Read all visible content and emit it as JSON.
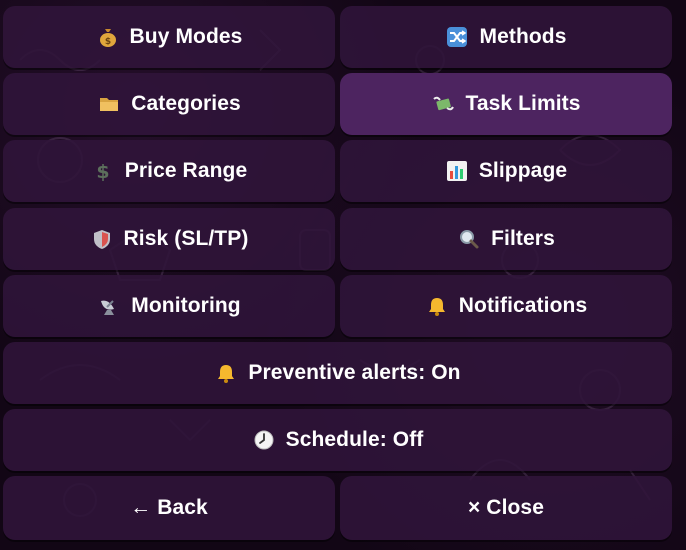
{
  "keyboard": {
    "rows": [
      [
        {
          "label": "Buy Modes",
          "icon": "money-bag-icon"
        },
        {
          "label": "Methods",
          "icon": "shuffle-icon"
        }
      ],
      [
        {
          "label": "Categories",
          "icon": "folder-icon"
        },
        {
          "label": "Task Limits",
          "icon": "money-wings-icon",
          "active": true
        }
      ],
      [
        {
          "label": "Price Range",
          "icon": "dollar-sign-icon"
        },
        {
          "label": "Slippage",
          "icon": "bar-chart-icon"
        }
      ],
      [
        {
          "label": "Risk (SL/TP)",
          "icon": "shield-icon"
        },
        {
          "label": "Filters",
          "icon": "magnifier-icon"
        }
      ],
      [
        {
          "label": "Monitoring",
          "icon": "satellite-dish-icon"
        },
        {
          "label": "Notifications",
          "icon": "bell-icon"
        }
      ],
      [
        {
          "label": "Preventive alerts: On",
          "icon": "bell-icon"
        }
      ],
      [
        {
          "label": "Schedule: Off",
          "icon": "clock-icon"
        }
      ],
      [
        {
          "label": "← Back"
        },
        {
          "label": "× Close"
        }
      ]
    ]
  },
  "colors": {
    "button": "#30143a",
    "button_active": "#4d2460",
    "text": "#ffffff",
    "background": "#120615"
  }
}
